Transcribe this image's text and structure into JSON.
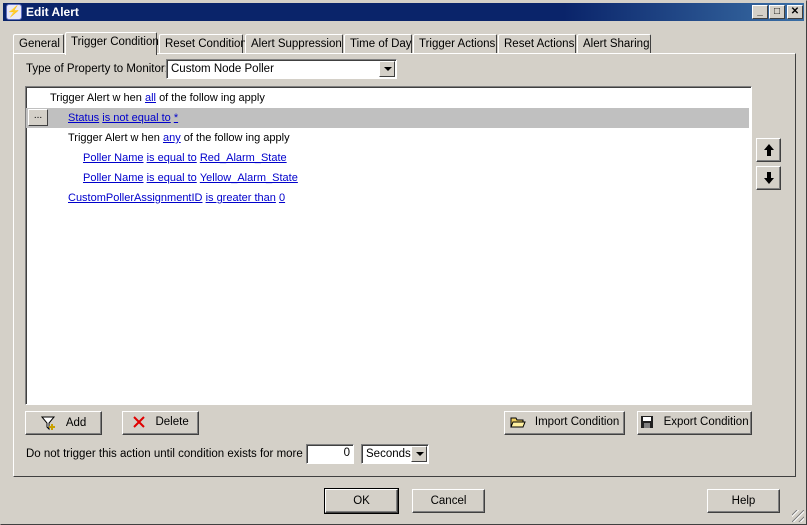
{
  "window": {
    "title": "Edit Alert"
  },
  "tabs": [
    {
      "label": "General"
    },
    {
      "label": "Trigger Condition"
    },
    {
      "label": "Reset Condition"
    },
    {
      "label": "Alert Suppression"
    },
    {
      "label": "Time of Day"
    },
    {
      "label": "Trigger Actions"
    },
    {
      "label": "Reset Actions"
    },
    {
      "label": "Alert Sharing"
    }
  ],
  "property": {
    "label": "Type of Property to Monitor:",
    "value": "Custom Node Poller"
  },
  "conditions": {
    "root": {
      "prefix": "Trigger Alert w hen",
      "link": "all",
      "suffix": "of the follow ing apply"
    },
    "status": {
      "ellipsis": "...",
      "field": "Status",
      "op": "is not equal to",
      "value": "*"
    },
    "group": {
      "prefix": "Trigger Alert w hen",
      "link": "any",
      "suffix": "of the follow ing apply"
    },
    "poller1": {
      "field": "Poller Name",
      "op": "is equal to",
      "value": "Red_Alarm_State"
    },
    "poller2": {
      "field": "Poller Name",
      "op": "is equal to",
      "value": "Yellow_Alarm_State"
    },
    "assignment": {
      "field": "CustomPollerAssignmentID",
      "op": "is greater than",
      "value": "0"
    }
  },
  "buttons": {
    "add": "Add",
    "delete": "Delete",
    "import": "Import Condition",
    "export": "Export Condition",
    "ok": "OK",
    "cancel": "Cancel",
    "help": "Help"
  },
  "delay": {
    "label": "Do not trigger this action until condition exists for more than",
    "value": "0",
    "unit": "Seconds"
  }
}
